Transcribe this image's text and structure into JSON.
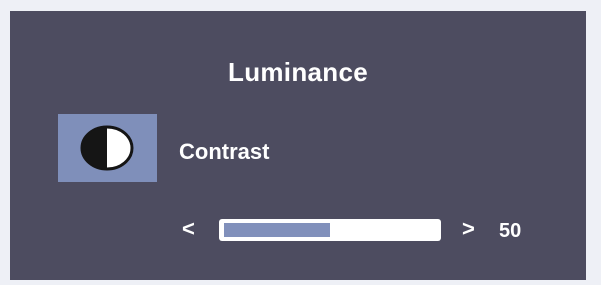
{
  "menu": {
    "title": "Luminance"
  },
  "item": {
    "label": "Contrast",
    "icon": "contrast-icon"
  },
  "slider": {
    "decrease_glyph": "<",
    "increase_glyph": ">",
    "value": "50",
    "level_percent": 50
  },
  "colors": {
    "panel": "#4d4c60",
    "highlight": "#7f8fba",
    "slider_fill": "#8190bb",
    "text": "#ffffff"
  }
}
